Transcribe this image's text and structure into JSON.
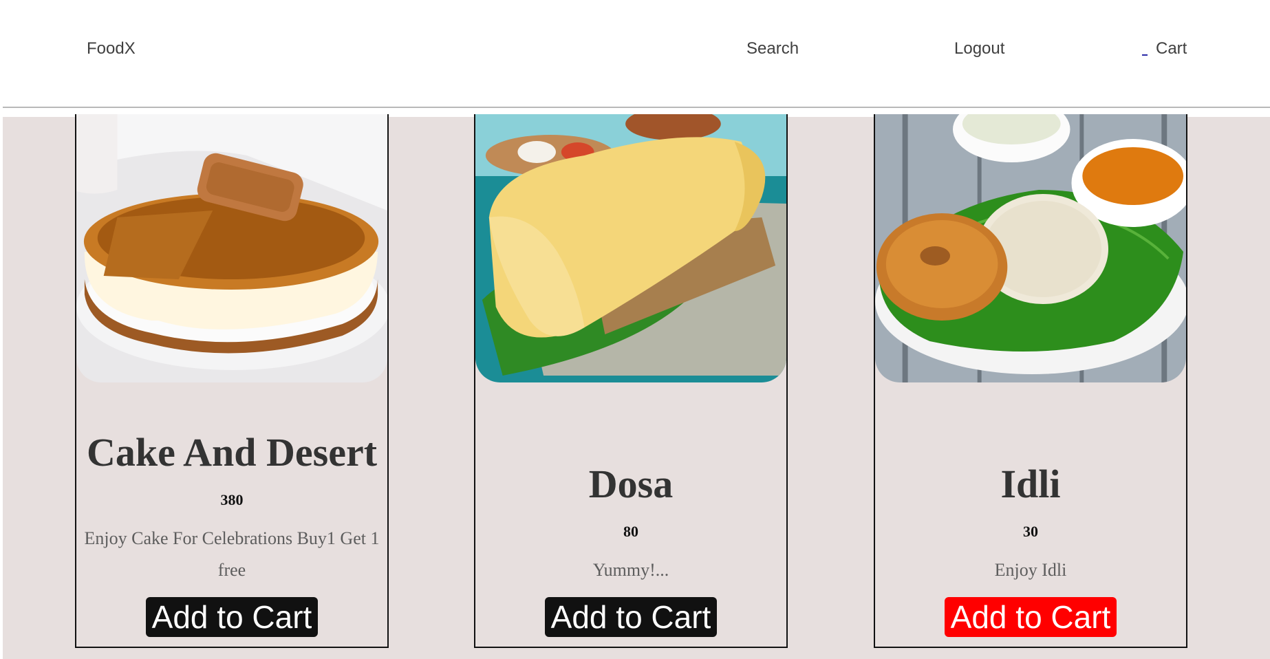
{
  "navbar": {
    "brand": "FoodX",
    "search": "Search",
    "logout": "Logout",
    "cart": "Cart",
    "cart_icon": "cart-icon"
  },
  "colors": {
    "page_background": "#e7dfde",
    "button": "#111111",
    "button_active": "#ff0000",
    "title": "#333333",
    "description": "#5d5d5d"
  },
  "products": [
    {
      "name": "Cake And Desert",
      "price": "380",
      "description": "Enjoy Cake For Celebrations Buy1 Get 1 free",
      "button": "Add to Cart",
      "image": "caramel-cheesecake"
    },
    {
      "name": "Dosa",
      "price": "80",
      "description": "Yummy!...",
      "button": "Add to Cart",
      "image": "dosa-plate"
    },
    {
      "name": "Idli",
      "price": "30",
      "description": "Enjoy Idli",
      "button": "Add to Cart",
      "image": "idli-vada-plate"
    }
  ]
}
